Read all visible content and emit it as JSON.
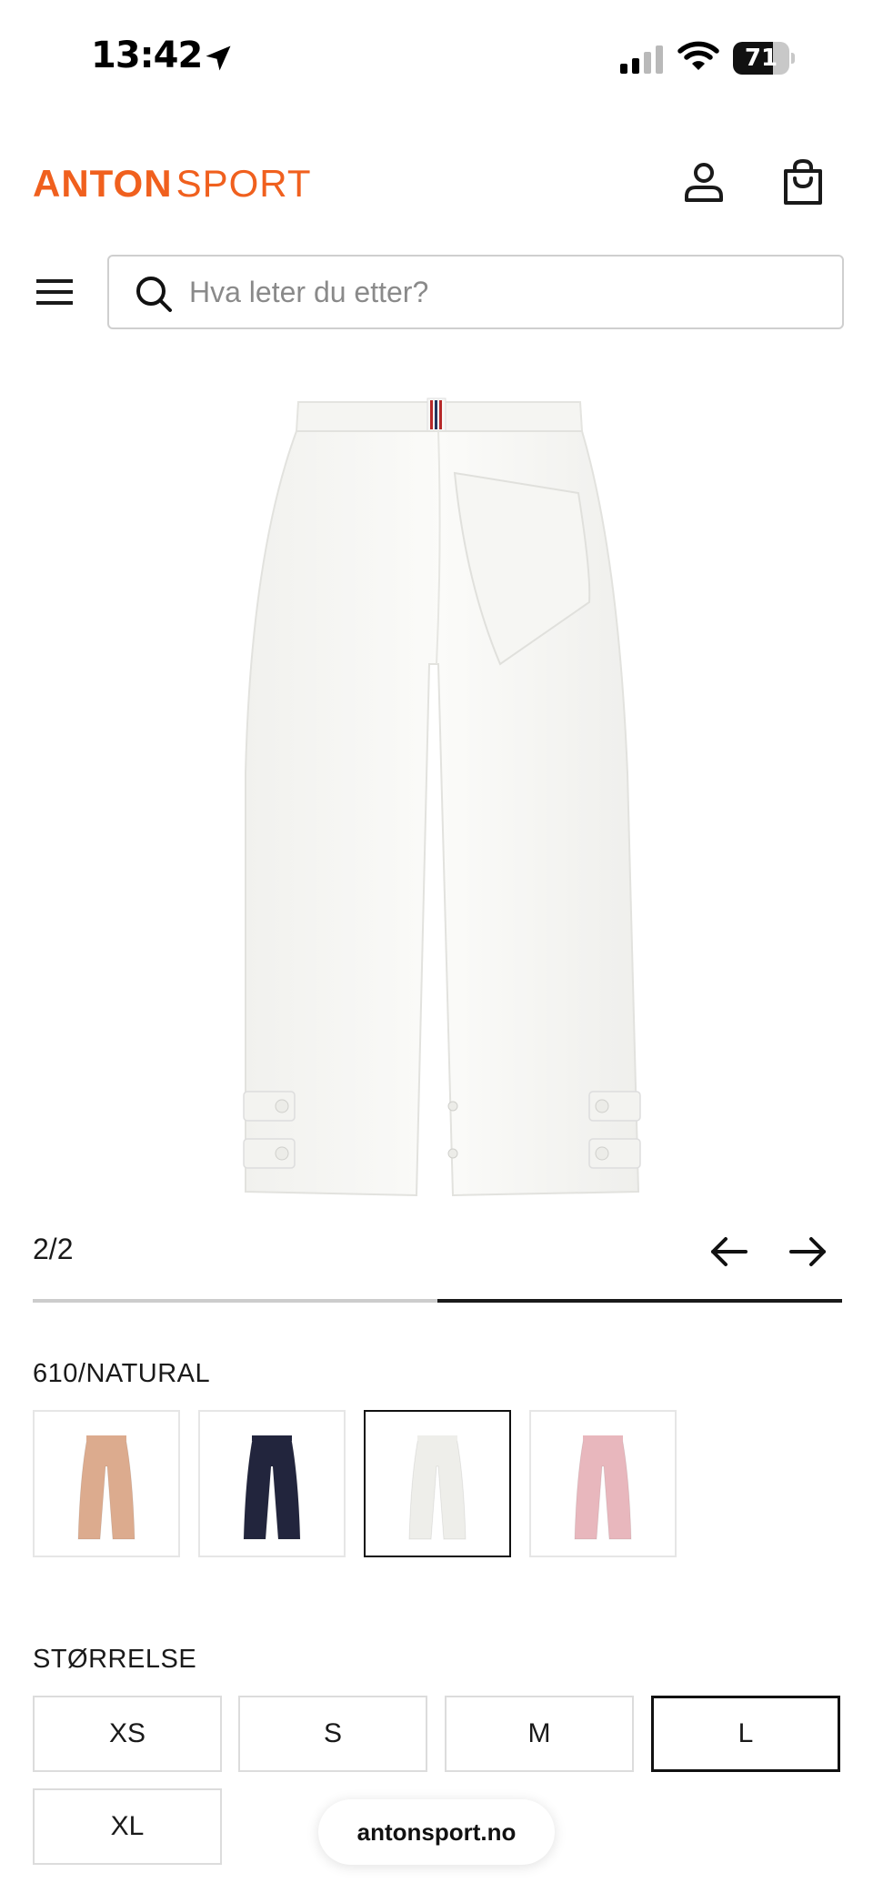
{
  "status_bar": {
    "time": "13:42",
    "battery_level": "71",
    "battery_fraction": 0.71
  },
  "header": {
    "logo_brand": "ANTON",
    "logo_sub": "SPORT",
    "brand_color": "#f0601e",
    "account_icon": "user-icon",
    "cart_icon": "shopping-bag-icon"
  },
  "search": {
    "placeholder": "Hva leter du etter?",
    "value": ""
  },
  "gallery": {
    "counter": "2/2",
    "current": 2,
    "total": 2,
    "prev_icon": "arrow-left-icon",
    "next_icon": "arrow-right-icon"
  },
  "color": {
    "selected_label": "610/NATURAL",
    "swatches": [
      {
        "color": "#dcab8e",
        "selected": false
      },
      {
        "color": "#22253d",
        "selected": false
      },
      {
        "color": "#eeeeea",
        "selected": true
      },
      {
        "color": "#e8b7bd",
        "selected": false
      }
    ]
  },
  "size": {
    "label": "STØRRELSE",
    "options": [
      {
        "label": "XS",
        "selected": false
      },
      {
        "label": "S",
        "selected": false
      },
      {
        "label": "M",
        "selected": false
      },
      {
        "label": "L",
        "selected": true
      },
      {
        "label": "XL",
        "selected": false
      }
    ]
  },
  "browser": {
    "url": "antonsport.no"
  }
}
